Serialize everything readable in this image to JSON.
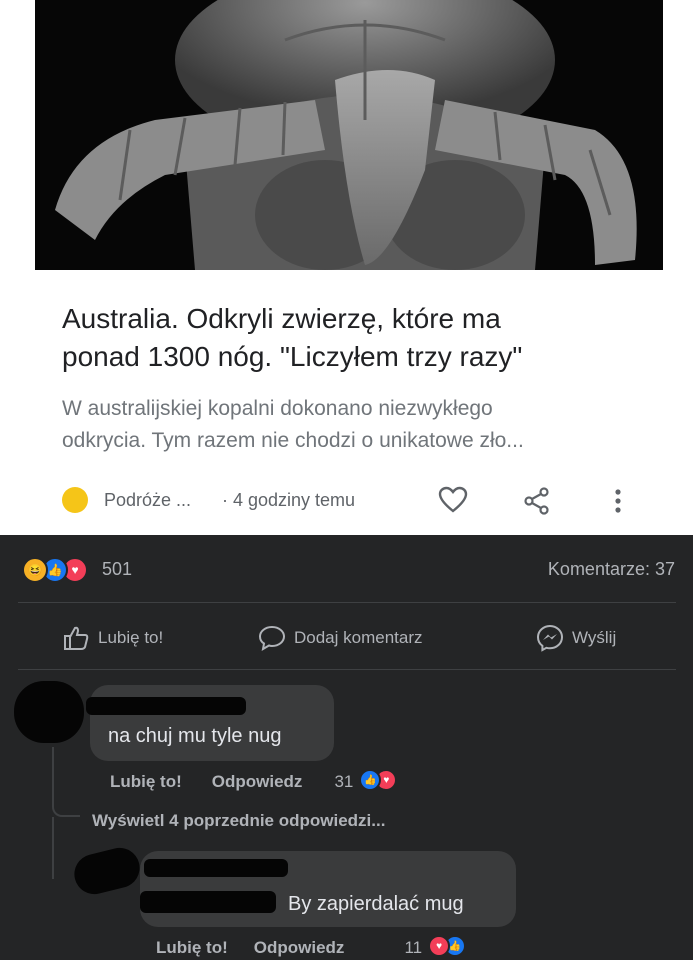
{
  "article": {
    "headline_line1": "Australia. Odkryli zwierzę, które ma",
    "headline_line2": "ponad 1300 nóg. \"Liczyłem trzy razy\"",
    "snippet_line1": "W australijskiej kopalni dokonano niezwykłego",
    "snippet_line2": "odkrycia. Tym razem nie chodzi o unikatowe zło...",
    "source": "Podróże ...",
    "time": "· 4 godziny temu",
    "icons": [
      "heart-icon",
      "share-icon",
      "more-vert-icon"
    ]
  },
  "post": {
    "reaction_count": "501",
    "comments_count": "Komentarze: 37",
    "actions": {
      "like": "Lubię to!",
      "comment": "Dodaj komentarz",
      "send": "Wyślij"
    }
  },
  "comments": [
    {
      "text": "na chuj mu tyle nug",
      "like": "Lubię to!",
      "reply": "Odpowiedz",
      "reactions": "31"
    }
  ],
  "view_replies": "Wyświetl 4 poprzednie odpowiedzi...",
  "reply": {
    "text": "By zapierdalać mug",
    "like": "Lubię to!",
    "reply": "Odpowiedz",
    "reactions": "11"
  },
  "colors": {
    "accent_blue": "#1877f2",
    "love_red": "#f33e58",
    "haha_yellow": "#f7b125",
    "source_dot": "#f5c518"
  }
}
